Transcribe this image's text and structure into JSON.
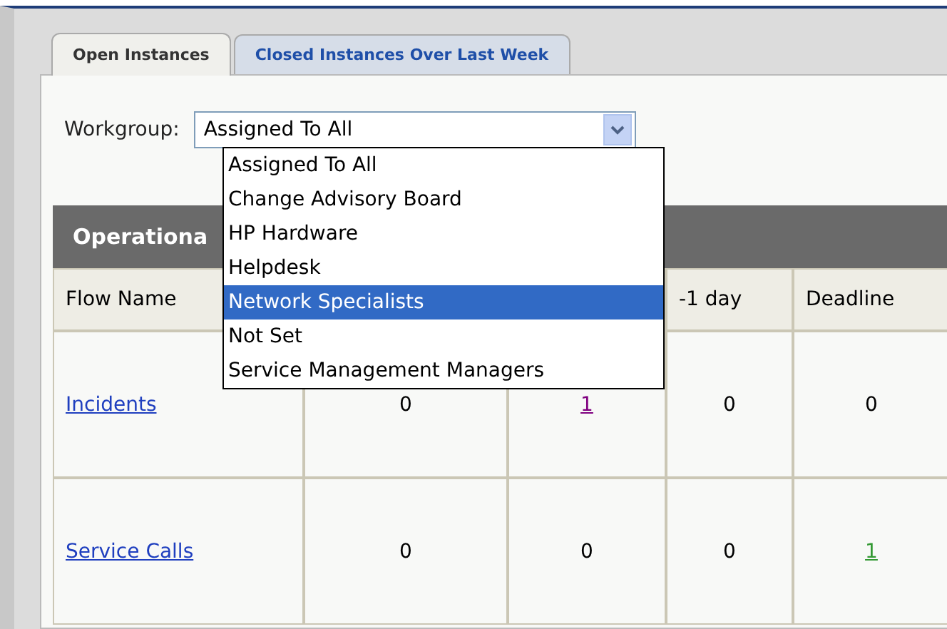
{
  "tabs": [
    {
      "label": "Open Instances",
      "selected": true
    },
    {
      "label": "Closed Instances Over Last Week",
      "selected": false
    }
  ],
  "workgroup": {
    "label": "Workgroup:",
    "value": "Assigned To All",
    "expanded": true,
    "options": [
      {
        "label": "Assigned To All",
        "highlighted": false
      },
      {
        "label": "Change Advisory Board",
        "highlighted": false
      },
      {
        "label": "HP Hardware",
        "highlighted": false
      },
      {
        "label": "Helpdesk",
        "highlighted": false
      },
      {
        "label": "Network Specialists",
        "highlighted": true
      },
      {
        "label": "Not Set",
        "highlighted": false
      },
      {
        "label": "Service Management Managers",
        "highlighted": false
      }
    ]
  },
  "section_title": "Operationa",
  "table": {
    "columns": [
      "Flow Name",
      "",
      "",
      "-1 day",
      "Deadline"
    ],
    "rows": [
      {
        "cells": [
          {
            "kind": "flow",
            "text": "Incidents"
          },
          {
            "kind": "text",
            "text": "0"
          },
          {
            "kind": "link",
            "text": "1",
            "color": "#800080"
          },
          {
            "kind": "text",
            "text": "0"
          },
          {
            "kind": "text",
            "text": "0"
          }
        ]
      },
      {
        "cells": [
          {
            "kind": "flow",
            "text": "Service Calls"
          },
          {
            "kind": "text",
            "text": "0"
          },
          {
            "kind": "text",
            "text": "0"
          },
          {
            "kind": "text",
            "text": "0"
          },
          {
            "kind": "link",
            "text": "1",
            "color": "#339933"
          }
        ]
      }
    ]
  }
}
